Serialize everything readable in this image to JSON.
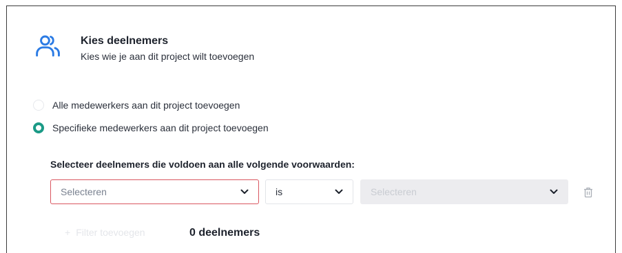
{
  "header": {
    "title": "Kies deelnemers",
    "subtitle": "Kies wie je aan dit project wilt toevoegen"
  },
  "options": [
    {
      "label": "Alle medewerkers aan dit project toevoegen",
      "selected": false
    },
    {
      "label": "Specifieke medewerkers aan dit project toevoegen",
      "selected": true
    }
  ],
  "conditions": {
    "label": "Selecteer deelnemers die voldoen aan alle volgende voorwaarden:",
    "field_placeholder": "Selecteren",
    "operator_value": "is",
    "value_placeholder": "Selecteren"
  },
  "footer": {
    "add_label": "Filter toevoegen",
    "participant_count": "0 deelnemers"
  },
  "colors": {
    "accent": "#1b9a86",
    "error_border": "#d9555f",
    "icon_blue": "#2b7be4"
  }
}
